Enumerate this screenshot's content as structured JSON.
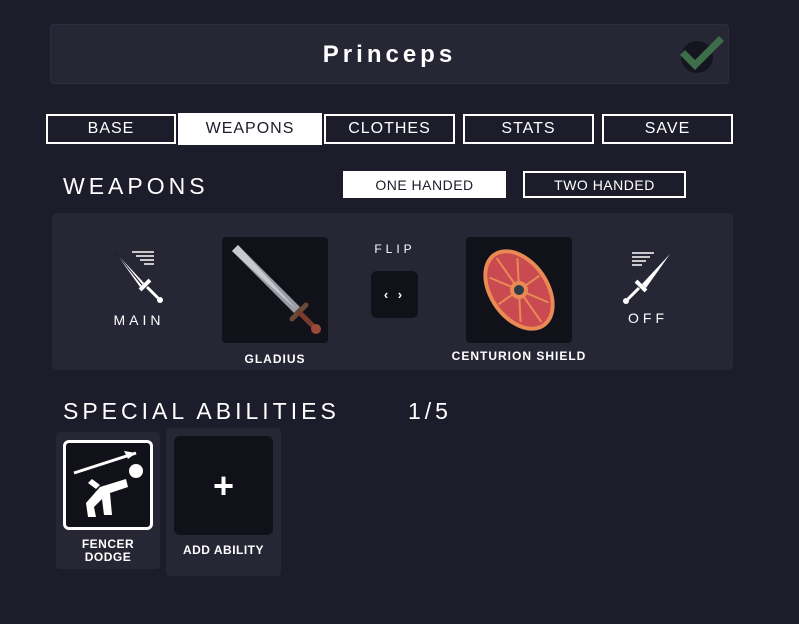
{
  "header": {
    "title": "Princeps",
    "confirm_icon": "checkmark-icon"
  },
  "tabs": [
    {
      "label": "BASE",
      "active": false
    },
    {
      "label": "WEAPONS",
      "active": true
    },
    {
      "label": "CLOTHES",
      "active": false
    },
    {
      "label": "STATS",
      "active": false
    },
    {
      "label": "SAVE",
      "active": false
    }
  ],
  "weapons": {
    "heading": "WEAPONS",
    "toggle": [
      {
        "label": "ONE HANDED",
        "active": true
      },
      {
        "label": "TWO HANDED",
        "active": false
      }
    ],
    "main_slot": {
      "label": "MAIN",
      "icon": "sword-icon",
      "item": "GLADIUS",
      "item_icon": "gladius-icon"
    },
    "flip": {
      "label": "FLIP",
      "button": "‹ ›"
    },
    "off_slot": {
      "label": "OFF",
      "icon": "sword-icon",
      "item": "CENTURION SHIELD",
      "item_icon": "shield-icon"
    }
  },
  "abilities": {
    "heading": "SPECIAL ABILITIES",
    "count": "1/5",
    "items": [
      {
        "label_line1": "FENCER",
        "label_line2": "DODGE",
        "icon": "fencer-dodge-icon"
      }
    ],
    "add": {
      "label": "ADD ABILITY",
      "symbol": "+"
    }
  },
  "colors": {
    "background": "#1c1c2a",
    "panel": "#262635",
    "slot": "#111119",
    "accent": "#ffffff",
    "shield_red": "#c94a50",
    "shield_rim": "#e98a55"
  }
}
